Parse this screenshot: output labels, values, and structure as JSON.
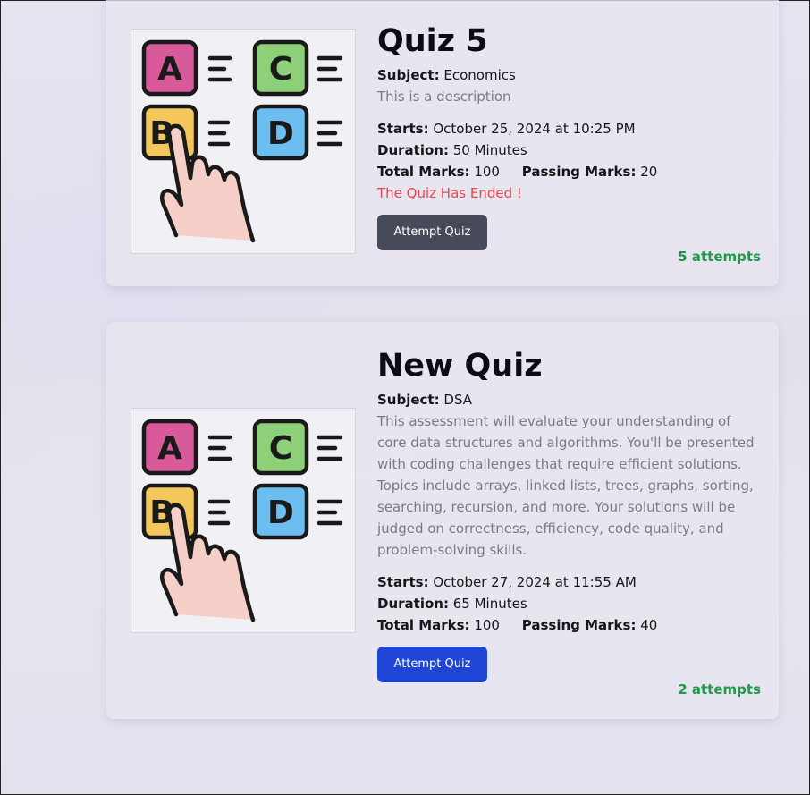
{
  "quizzes": [
    {
      "title": "Quiz 5",
      "subject_label": "Subject:",
      "subject": "Economics",
      "description": "This is a description",
      "starts_label": "Starts:",
      "starts": "October 25, 2024 at 10:25 PM",
      "duration_label": "Duration:",
      "duration": "50 Minutes",
      "total_label": "Total Marks:",
      "total": "100",
      "passing_label": "Passing Marks:",
      "passing": "20",
      "status": "The Quiz Has Ended !",
      "button": "Attempt Quiz",
      "attempts": "5 attempts",
      "image_icon": "quiz-abcd-hand-icon"
    },
    {
      "title": "New Quiz",
      "subject_label": "Subject:",
      "subject": "DSA",
      "description": "This assessment will evaluate your understanding of core data structures and algorithms. You'll be presented with coding challenges that require efficient solutions. Topics include arrays, linked lists, trees, graphs, sorting, searching, recursion, and more. Your solutions will be judged on correctness, efficiency, code quality, and problem-solving skills.",
      "starts_label": "Starts:",
      "starts": "October 27, 2024 at 11:55 AM",
      "duration_label": "Duration:",
      "duration": "65 Minutes",
      "total_label": "Total Marks:",
      "total": "100",
      "passing_label": "Passing Marks:",
      "passing": "40",
      "button": "Attempt Quiz",
      "attempts": "2 attempts",
      "image_icon": "quiz-abcd-hand-icon"
    }
  ],
  "colors": {
    "ended": "#e5484d",
    "attempts": "#1f9a4a",
    "button_disabled": "#474a58",
    "button_primary": "#1e45d3",
    "option_a": "#d95a9a",
    "option_b": "#f3c75a",
    "option_c": "#8ed07a",
    "option_d": "#6cbdf0"
  }
}
